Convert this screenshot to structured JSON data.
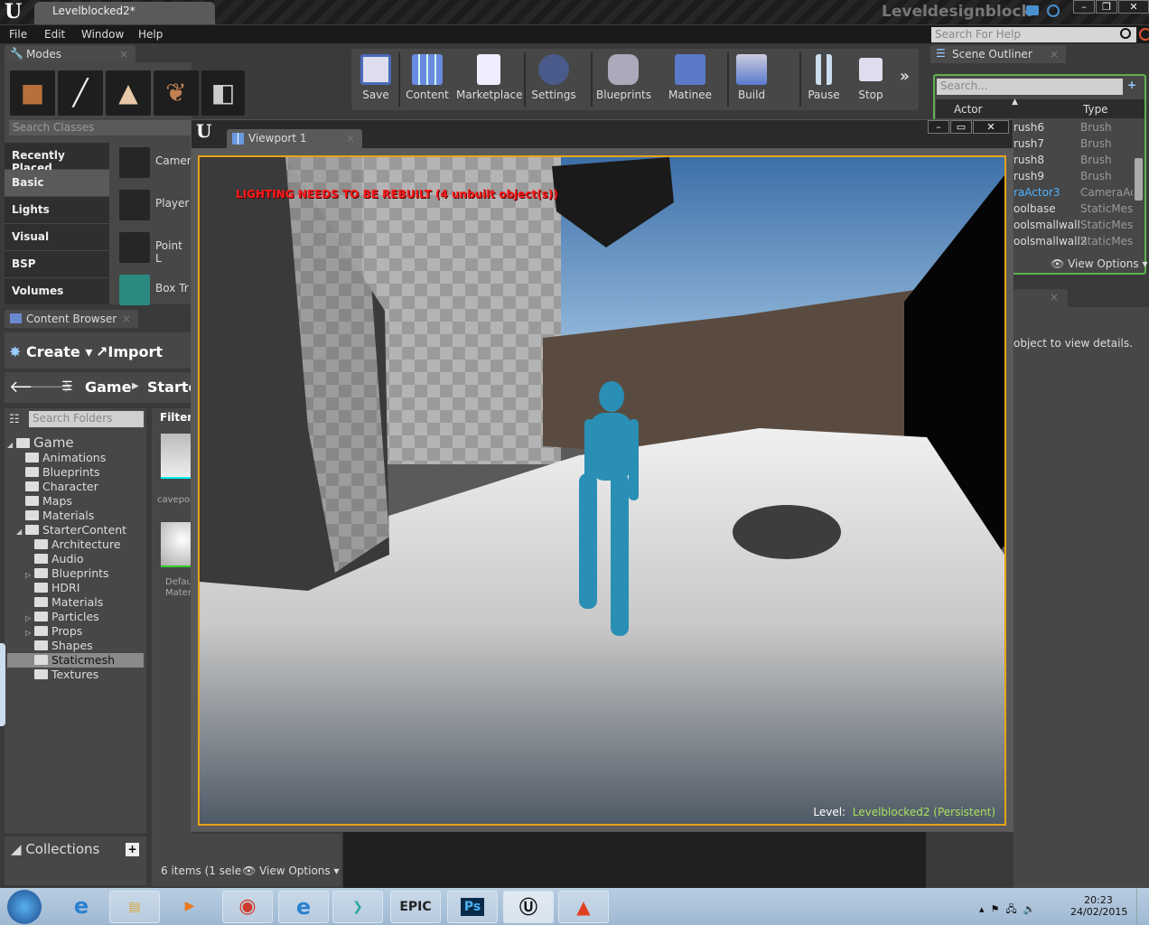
{
  "titlebar": {
    "document_tab": "Levelblocked2*",
    "project_name": "Leveldesignblock",
    "buttons": [
      "minimize",
      "restore",
      "close"
    ]
  },
  "menu": {
    "items": [
      "File",
      "Edit",
      "Window",
      "Help"
    ],
    "help_search_placeholder": "Search For Help"
  },
  "modes": {
    "tab": "Modes",
    "mode_icons": [
      "place-mode-icon",
      "paint-mode-icon",
      "landscape-mode-icon",
      "foliage-mode-icon",
      "geometry-mode-icon"
    ],
    "search_placeholder": "Search Classes",
    "categories": [
      "Recently Placed",
      "Basic",
      "Lights",
      "Visual",
      "BSP",
      "Volumes"
    ],
    "selected_category": "Basic",
    "items": [
      "Camer",
      "Player",
      "Point L",
      "Box Tr"
    ]
  },
  "content_browser": {
    "tab": "Content Browser",
    "create": "Create",
    "import": "Import",
    "breadcrumb": [
      "Game",
      "Starte"
    ],
    "search_folders_placeholder": "Search Folders",
    "filters": "Filters",
    "folders": [
      {
        "name": "Game",
        "level": 0,
        "expanded": true
      },
      {
        "name": "Animations",
        "level": 1
      },
      {
        "name": "Blueprints",
        "level": 1
      },
      {
        "name": "Character",
        "level": 1
      },
      {
        "name": "Maps",
        "level": 1
      },
      {
        "name": "Materials",
        "level": 1
      },
      {
        "name": "StarterContent",
        "level": 1,
        "expanded": true
      },
      {
        "name": "Architecture",
        "level": 2
      },
      {
        "name": "Audio",
        "level": 2
      },
      {
        "name": "Blueprints",
        "level": 2,
        "collapsed": true
      },
      {
        "name": "HDRI",
        "level": 2
      },
      {
        "name": "Materials",
        "level": 2
      },
      {
        "name": "Particles",
        "level": 2,
        "collapsed": true
      },
      {
        "name": "Props",
        "level": 2,
        "collapsed": true
      },
      {
        "name": "Shapes",
        "level": 2
      },
      {
        "name": "Staticmesh",
        "level": 2,
        "selected": true
      },
      {
        "name": "Textures",
        "level": 2
      }
    ],
    "assets": [
      {
        "name": "cavepoc"
      },
      {
        "name": "Defau",
        "line2": "Mater"
      }
    ],
    "collections": "Collections",
    "status": "6 items (1 sele",
    "view_options": "View Options"
  },
  "toolbar": {
    "buttons": [
      "Save",
      "Content",
      "Marketplace",
      "Settings",
      "Blueprints",
      "Matinee",
      "Build",
      "Pause",
      "Stop"
    ]
  },
  "viewport": {
    "tab": "Viewport 1",
    "warning": "LIGHTING NEEDS TO BE REBUILT (4 unbuilt object(s))",
    "level_label": "Level:",
    "level_name": "Levelblocked2 (Persistent)"
  },
  "outliner": {
    "tab": "Scene Outliner",
    "search_placeholder": "Search...",
    "col_actor": "Actor",
    "col_type": "Type",
    "rows": [
      {
        "actor": "rush6",
        "type": "Brush"
      },
      {
        "actor": "rush7",
        "type": "Brush"
      },
      {
        "actor": "rush8",
        "type": "Brush"
      },
      {
        "actor": "rush9",
        "type": "Brush"
      },
      {
        "actor": "raActor3",
        "type": "CameraAc",
        "highlight": true
      },
      {
        "actor": "oolbase",
        "type": "StaticMesh"
      },
      {
        "actor": "oolsmallwall",
        "type": "StaticMesh"
      },
      {
        "actor": "oolsmallwall2",
        "type": "StaticMesh"
      }
    ],
    "view_options": "View Options"
  },
  "details": {
    "hint": "object to view details."
  },
  "taskbar": {
    "apps": [
      "start",
      "ie",
      "explorer",
      "media-player",
      "chrome",
      "ie",
      "maya",
      "epic-games",
      "photoshop",
      "unreal",
      "mudbox"
    ],
    "labels": {
      "epic": "EPIC",
      "ps": "Ps"
    },
    "time": "20:23",
    "date": "24/02/2015"
  },
  "colors": {
    "accent": "#e8a317",
    "warning": "#ff1a1a",
    "selected_actor": "#4fb3ff",
    "outliner_border": "#5fb04f"
  }
}
